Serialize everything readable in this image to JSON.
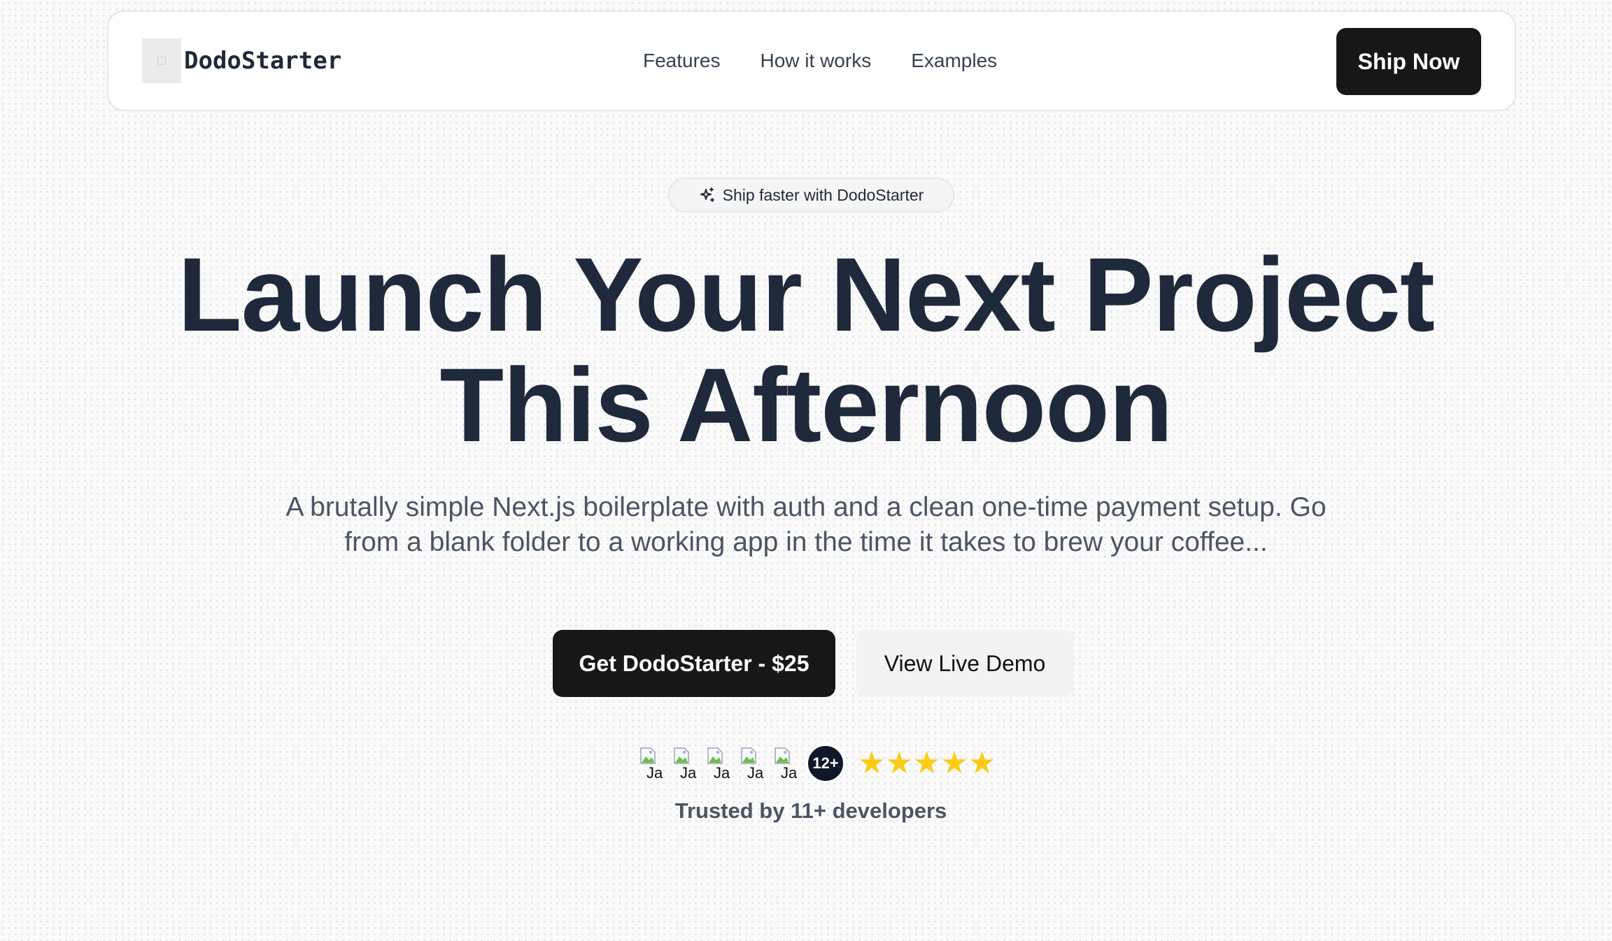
{
  "navbar": {
    "brand_name": "DodoStarter",
    "brand_logo_icon": "logo-placeholder",
    "links": [
      {
        "label": "Features"
      },
      {
        "label": "How it works"
      },
      {
        "label": "Examples"
      }
    ],
    "cta_label": "Ship Now"
  },
  "hero": {
    "badge_icon": "sparkles-icon",
    "badge_text": "Ship faster with DodoStarter",
    "headline_line1": "Launch Your Next Project",
    "headline_line2": "This Afternoon",
    "subtext": "A brutally simple Next.js boilerplate with auth and a clean one-time payment setup. Go from a blank folder to a working app in the time it takes to brew your coffee...",
    "primary_cta": "Get DodoStarter - $25",
    "secondary_cta": "View Live Demo"
  },
  "social_proof": {
    "avatars": [
      {
        "alt": "Ja"
      },
      {
        "alt": "Ja"
      },
      {
        "alt": "Ja"
      },
      {
        "alt": "Ja"
      },
      {
        "alt": "Ja"
      }
    ],
    "count_badge": "12+",
    "stars": [
      "★",
      "★",
      "★",
      "★",
      "★"
    ],
    "rating_value": 5,
    "trusted_text": "Trusted by 11+ developers"
  },
  "colors": {
    "primary_dark": "#171717",
    "heading": "#1e293b",
    "body_text": "#4b5563",
    "star": "#facc15",
    "count_badge_bg": "#0f172a"
  }
}
